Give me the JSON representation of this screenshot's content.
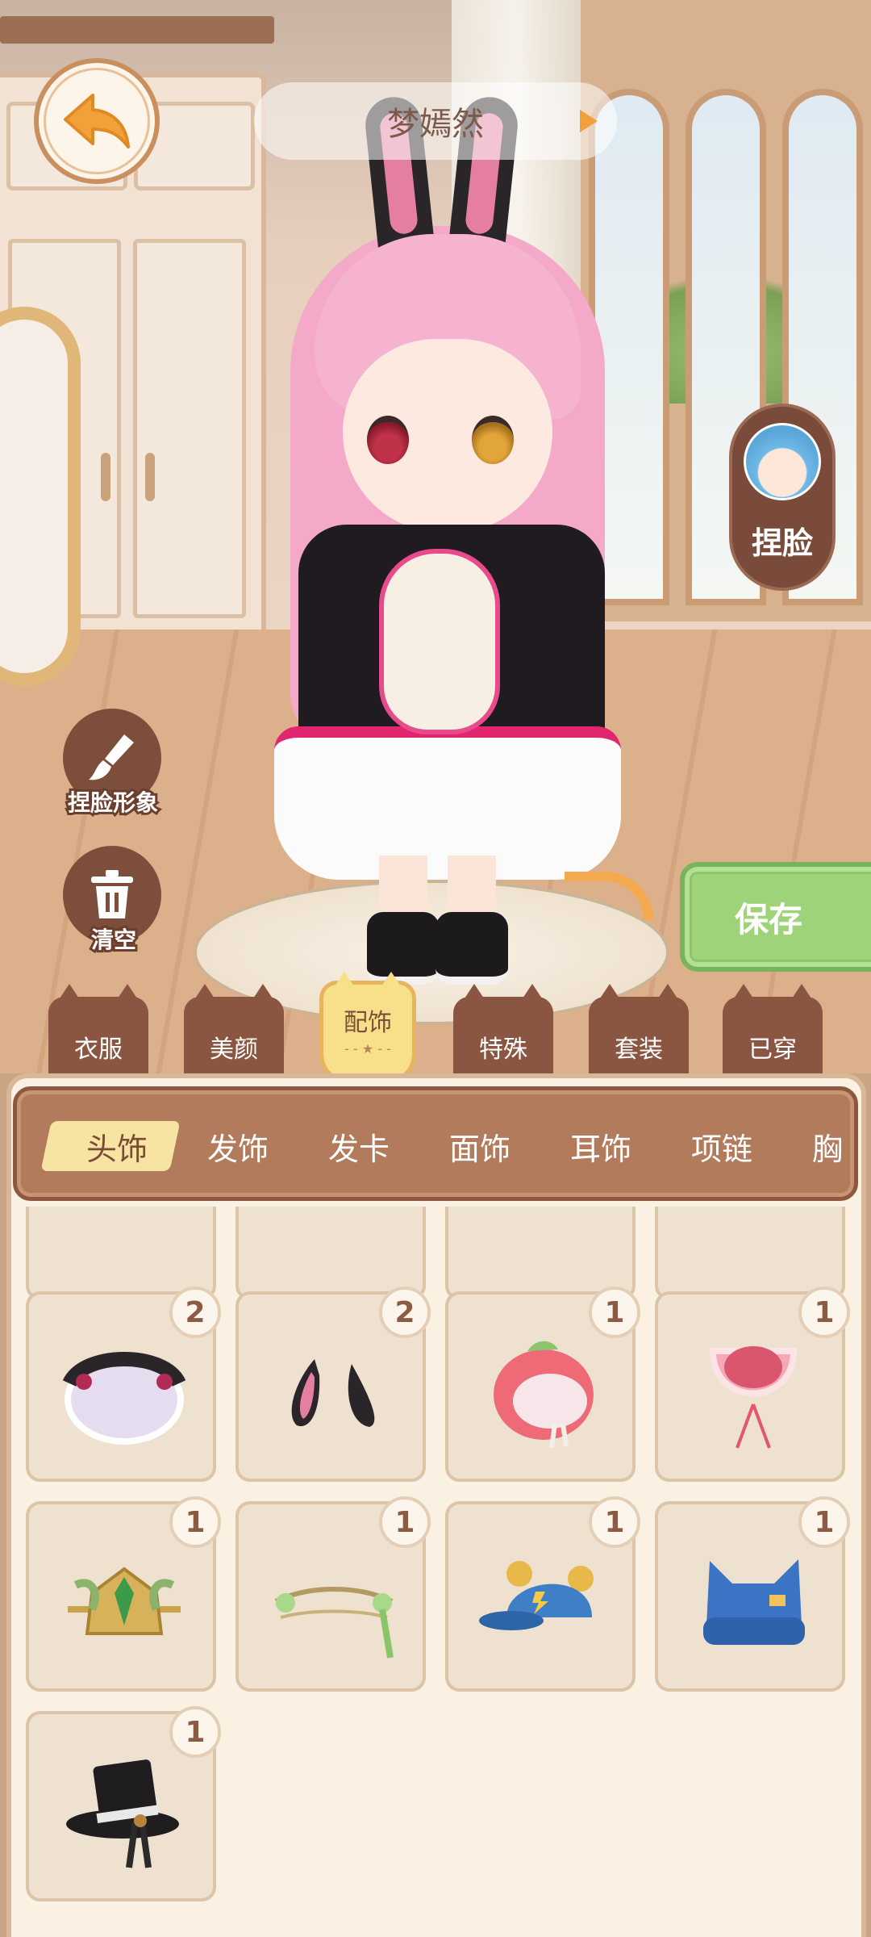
{
  "header": {
    "character_name": "梦嫣然"
  },
  "side_actions": {
    "face_button_label": "捏脸",
    "brush_label": "捏脸形象",
    "clear_label": "清空"
  },
  "save_label": "保存",
  "category_tabs": [
    {
      "label": "衣服",
      "active": false
    },
    {
      "label": "美颜",
      "active": false
    },
    {
      "label": "配饰",
      "active": true
    },
    {
      "label": "特殊",
      "active": false
    },
    {
      "label": "套装",
      "active": false
    },
    {
      "label": "已穿",
      "active": false
    }
  ],
  "subcategories": [
    {
      "label": "头饰",
      "active": true
    },
    {
      "label": "发饰",
      "active": false
    },
    {
      "label": "发卡",
      "active": false
    },
    {
      "label": "面饰",
      "active": false
    },
    {
      "label": "耳饰",
      "active": false
    },
    {
      "label": "项链",
      "active": false
    },
    {
      "label": "胸",
      "active": false
    }
  ],
  "items": [
    {
      "icon": "maid-headband-icon",
      "count": "2"
    },
    {
      "icon": "bunny-ears-icon",
      "count": "2"
    },
    {
      "icon": "peach-cap-icon",
      "count": "1"
    },
    {
      "icon": "pink-bonnet-icon",
      "count": "1"
    },
    {
      "icon": "golden-crown-icon",
      "count": "1"
    },
    {
      "icon": "leaf-vine-circlet-icon",
      "count": "1"
    },
    {
      "icon": "blue-bear-cap-icon",
      "count": "1"
    },
    {
      "icon": "blue-cat-beanie-icon",
      "count": "1"
    },
    {
      "icon": "black-top-hat-icon",
      "count": "1"
    }
  ],
  "colors": {
    "accent_brown": "#8a5541",
    "active_tab": "#f8df8a",
    "save_green": "#9fd37a",
    "panel_bg": "#fbf1e3"
  }
}
